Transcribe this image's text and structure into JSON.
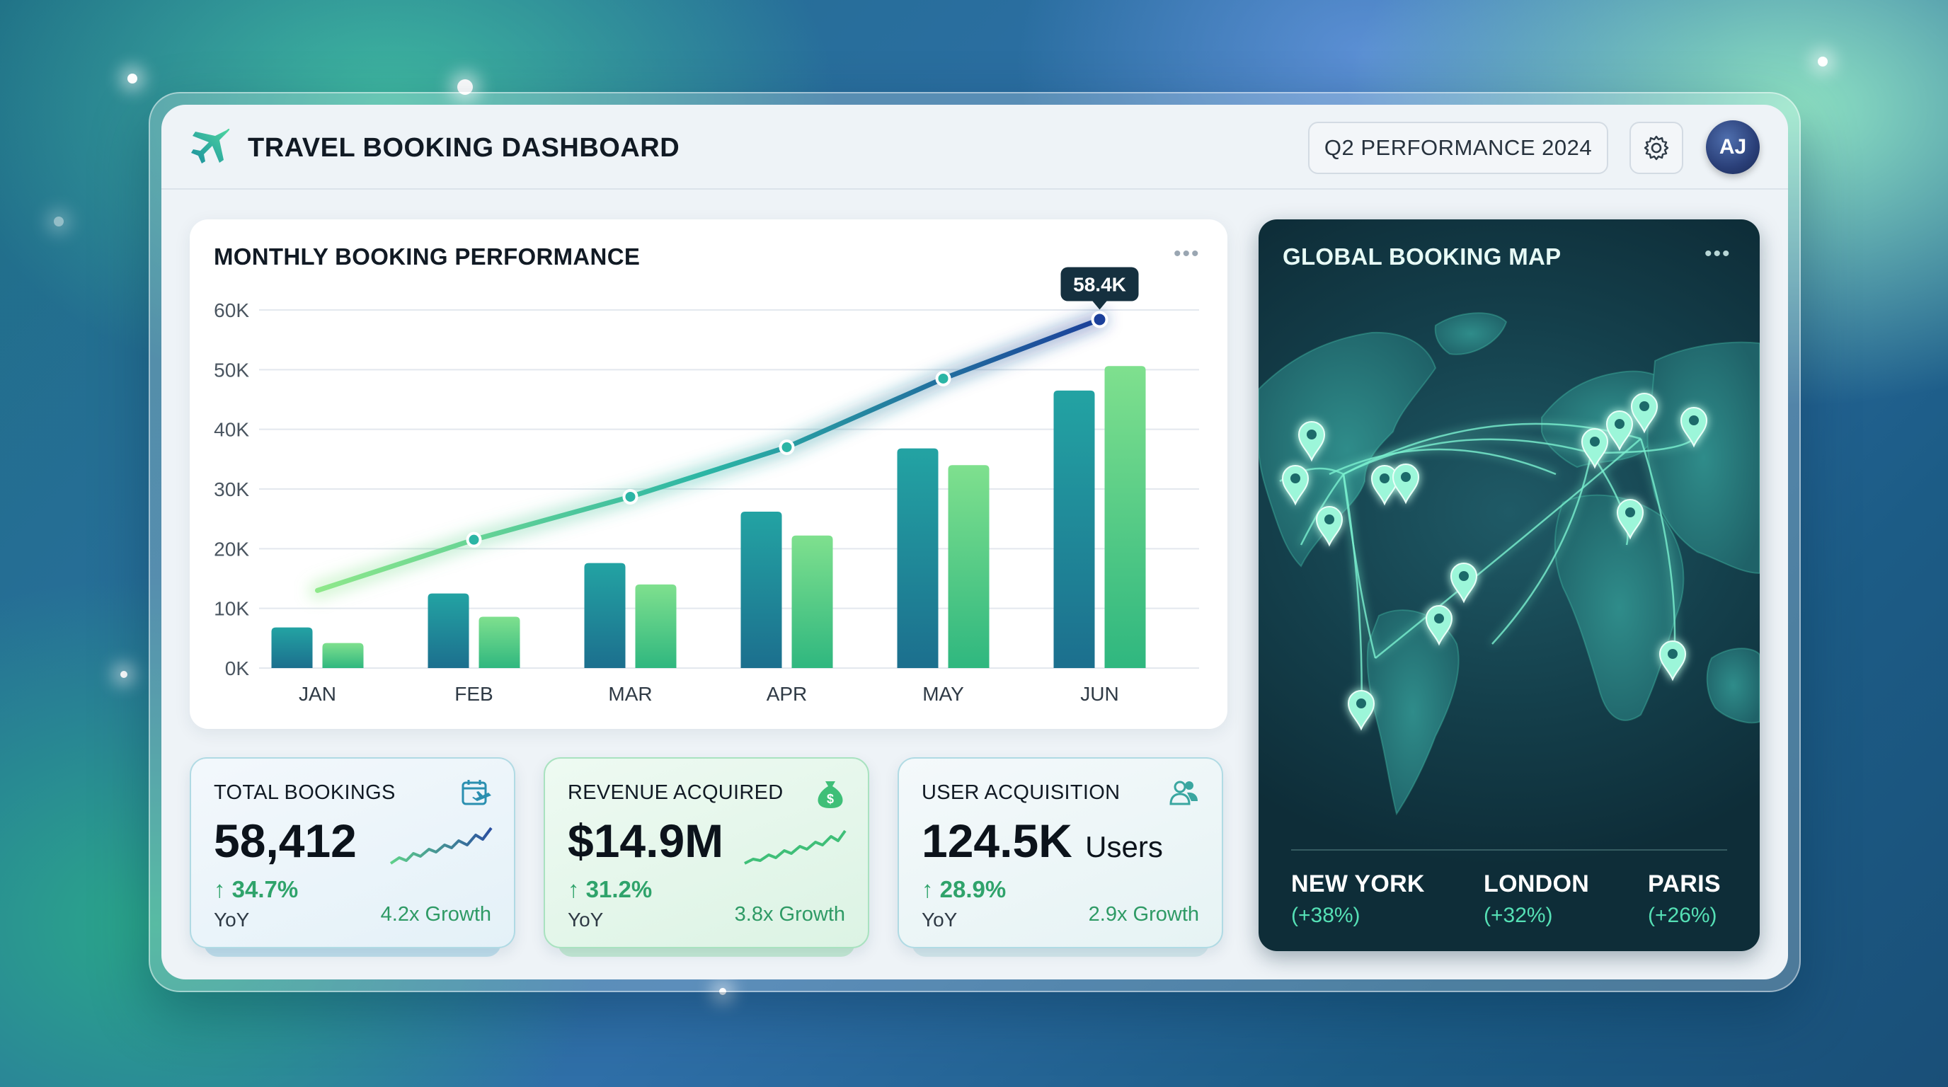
{
  "header": {
    "title": "TRAVEL BOOKING DASHBOARD",
    "period_label": "Q2 PERFORMANCE 2024",
    "avatar_initials": "AJ"
  },
  "booking_chart": {
    "title": "MONTHLY BOOKING PERFORMANCE",
    "highlight_label": "58.4K"
  },
  "chart_data": {
    "type": "bar",
    "title": "MONTHLY BOOKING PERFORMANCE",
    "categories": [
      "JAN",
      "FEB",
      "MAR",
      "APR",
      "MAY",
      "JUN"
    ],
    "y_ticks": [
      "0K",
      "10K",
      "20K",
      "30K",
      "40K",
      "50K",
      "60K"
    ],
    "ylim": [
      0,
      60000
    ],
    "series": [
      {
        "type": "bar",
        "values": [
          6800,
          12500,
          17600,
          26200,
          36800,
          46500
        ],
        "color": "#1f8a9a"
      },
      {
        "type": "bar",
        "values": [
          4200,
          8600,
          14000,
          22200,
          34000,
          50600
        ],
        "color": "#5fd18a"
      },
      {
        "type": "line",
        "values": [
          13000,
          21500,
          28700,
          37000,
          48500,
          58400
        ],
        "color": "#2bb5a5"
      }
    ],
    "annotation": "58.4K",
    "grid": true
  },
  "map": {
    "title": "GLOBAL BOOKING MAP",
    "cities": [
      {
        "name": "NEW YORK",
        "change": "(+38%)"
      },
      {
        "name": "LONDON",
        "change": "(+32%)"
      },
      {
        "name": "PARIS",
        "change": "(+26%)"
      }
    ]
  },
  "kpis": [
    {
      "title": "TOTAL BOOKINGS",
      "value": "58,412",
      "unit": "",
      "change": "↑ 34.7%",
      "yoy": "YoY",
      "growth": "4.2x Growth",
      "icon": "calendar-plane-icon"
    },
    {
      "title": "REVENUE ACQUIRED",
      "value": "$14.9M",
      "unit": "",
      "change": "↑ 31.2%",
      "yoy": "YoY",
      "growth": "3.8x Growth",
      "icon": "money-bag-icon"
    },
    {
      "title": "USER ACQUISITION",
      "value": "124.5K",
      "unit": "Users",
      "change": "↑ 28.9%",
      "yoy": "YoY",
      "growth": "2.9x Growth",
      "icon": "users-icon"
    }
  ],
  "colors": {
    "accent_teal": "#1f8a9a",
    "accent_green": "#5fd18a",
    "growth_green": "#2fa36b",
    "map_glow": "#55e0b5"
  }
}
